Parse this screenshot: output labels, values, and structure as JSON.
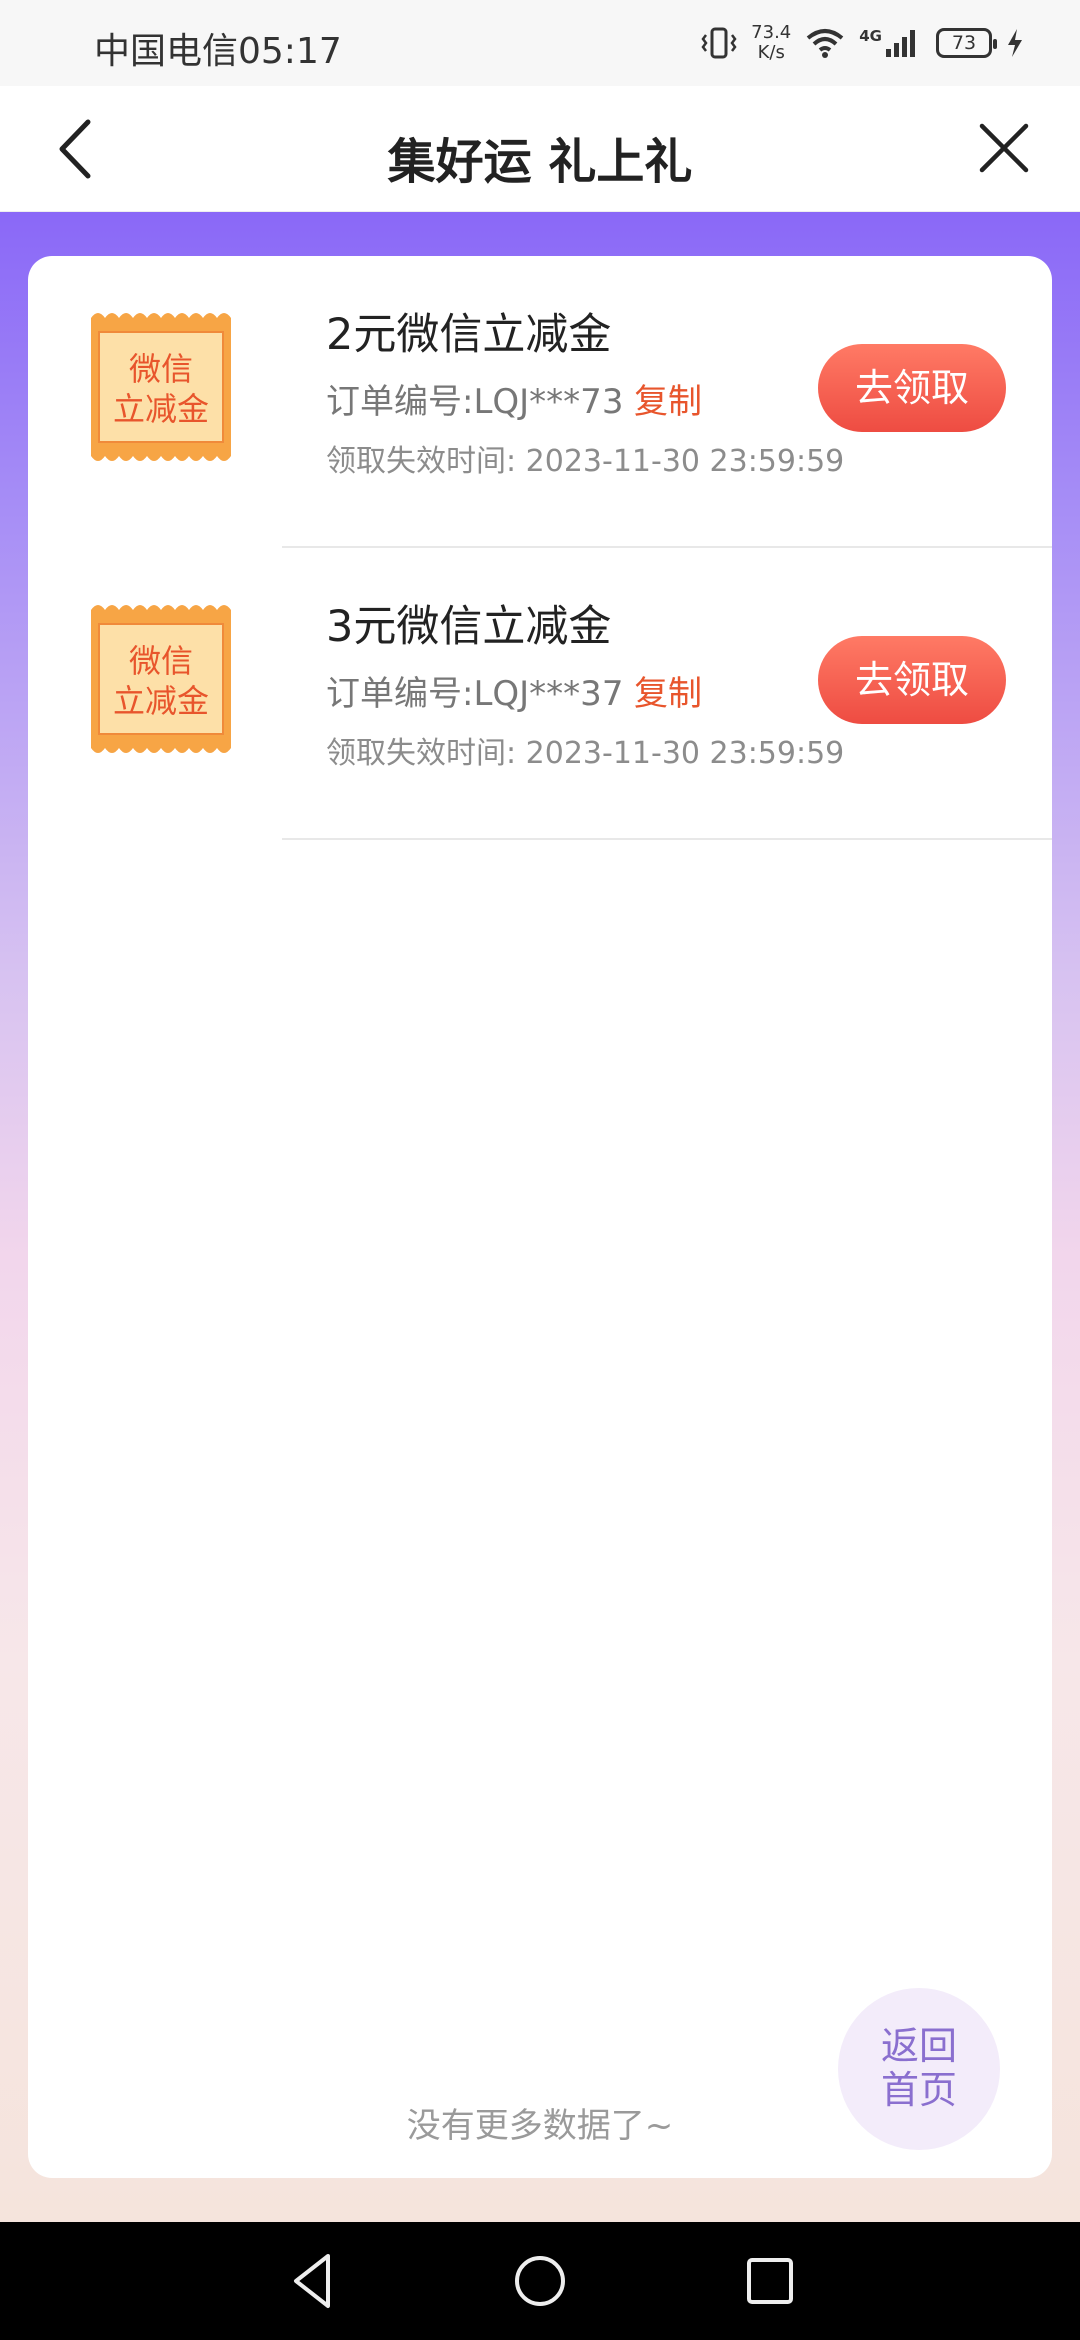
{
  "status_bar": {
    "carrier_time": "中国电信05:17",
    "net_speed_value": "73.4",
    "net_speed_unit": "K/s",
    "network_type": "4G",
    "battery": "73"
  },
  "nav": {
    "title": "集好运 礼上礼"
  },
  "coupon_icon_text": [
    "微信",
    "立减金"
  ],
  "items": [
    {
      "title": "2元微信立减金",
      "order": "订单编号:LQJ***73",
      "copy_label": "复制",
      "expire": "领取失效时间: 2023-11-30 23:59:59",
      "button": "去领取"
    },
    {
      "title": "3元微信立减金",
      "order": "订单编号:LQJ***37",
      "copy_label": "复制",
      "expire": "领取失效时间: 2023-11-30 23:59:59",
      "button": "去领取"
    }
  ],
  "footer": {
    "no_more": "没有更多数据了~",
    "home_line1": "返回",
    "home_line2": "首页"
  }
}
